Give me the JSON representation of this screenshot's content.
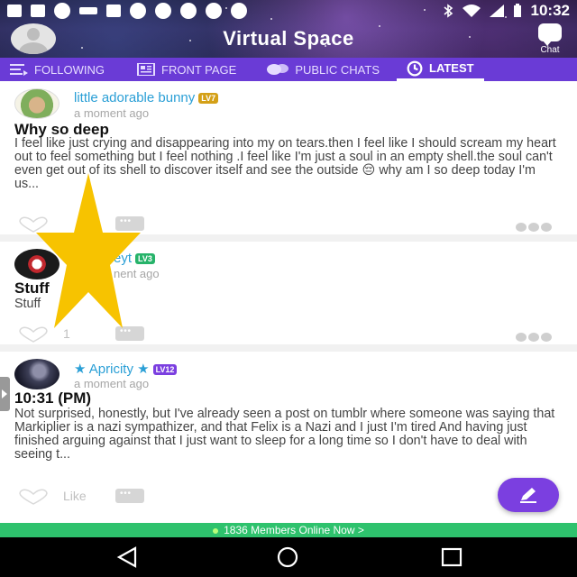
{
  "status_bar": {
    "time": "10:32",
    "left_icons": [
      "message-icon",
      "facebook-icon",
      "skype-icon",
      "signal-icon",
      "facebook-icon",
      "circle-icon",
      "circle-icon",
      "circle-icon",
      "circle-icon",
      "circle-icon"
    ],
    "right_icons": [
      "bluetooth-icon",
      "wifi-icon",
      "cellular-icon",
      "battery-icon"
    ]
  },
  "header": {
    "title": "Virtual Space",
    "chat_label": "Chat"
  },
  "tabs": [
    {
      "label": "FOLLOWING",
      "icon": "list-icon",
      "active": false
    },
    {
      "label": "FRONT PAGE",
      "icon": "newspaper-icon",
      "active": false
    },
    {
      "label": "PUBLIC CHATS",
      "icon": "chat-bubbles-icon",
      "active": false
    },
    {
      "label": "LATEST",
      "icon": "clock-icon",
      "active": true
    }
  ],
  "posts": [
    {
      "author": "little adorable bunny",
      "level": "LV7",
      "level_color": "#d4a017",
      "time": "a moment ago",
      "title": "Why so deep",
      "body": "I feel like just crying and disappearing into my on tears.then I feel like I should scream my heart out to feel something but I feel nothing .I feel like I'm just a soul in an empty shell.the soul can't even get out of its shell to discover itself and see the outside 😔 why am I so deep today I'm us...",
      "like_count": "",
      "author_color": "#2a9fd6"
    },
    {
      "author": "eyt",
      "level": "LV3",
      "level_color": "#27b36a",
      "time": "nent ago",
      "title": "Stuff",
      "body": "Stuff",
      "like_count": "1",
      "author_color": "#2a9fd6"
    },
    {
      "author": "★ Apricity ★",
      "level": "LV12",
      "level_color": "#7b3fe0",
      "time": "a moment ago",
      "title": "10:31 (PM)",
      "body": "Not surprised, honestly, but I've already seen a post on tumblr where someone was saying that Markiplier is a nazi sympathizer, and that Felix is a Nazi and I just I'm tired And having just finished arguing against that I just want to sleep for a long time so I don't have to deal with seeing t...",
      "like_count": "Like",
      "author_color": "#2a9fd6"
    }
  ],
  "members_online": "1836 Members Online Now",
  "colors": {
    "tab_bar": "#6a3bd6",
    "accent": "#7b3fe0",
    "members_bar": "#2ec26d",
    "star": "#f7c300"
  }
}
